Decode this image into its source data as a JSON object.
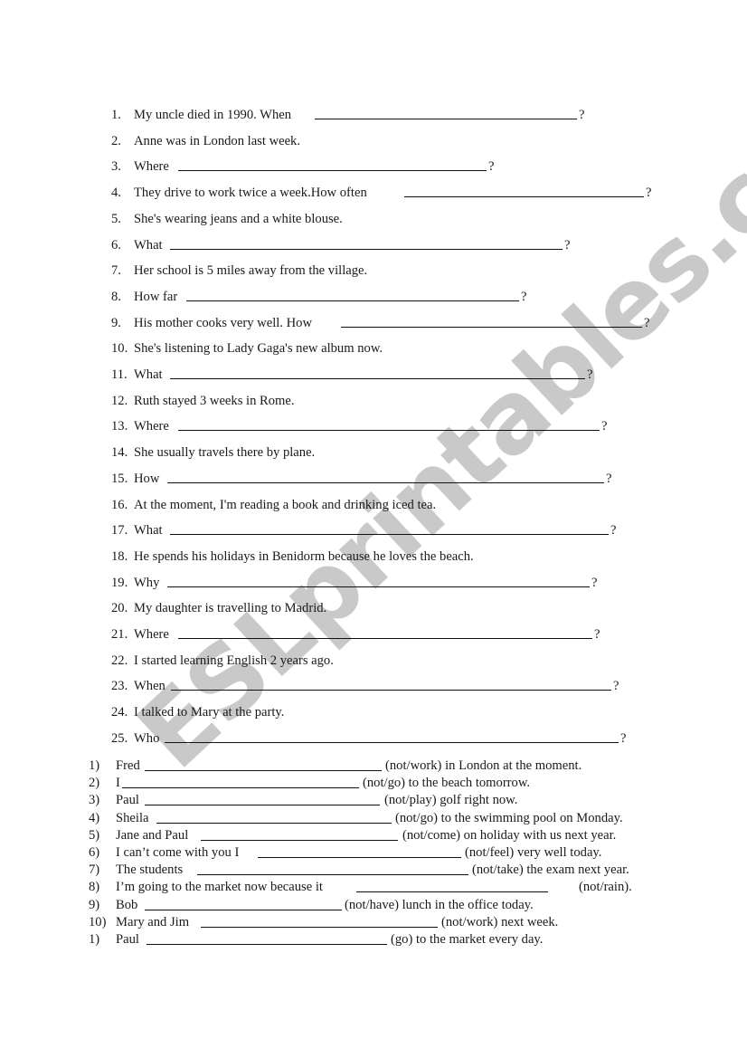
{
  "watermark": "ESLprintables.com",
  "section1": {
    "items": [
      {
        "num": "1.",
        "text": "My uncle died in 1990. When",
        "blank": true,
        "end": "?"
      },
      {
        "num": "2.",
        "text": "Anne was in London last week.",
        "blank": false,
        "end": ""
      },
      {
        "num": "3.",
        "text": "Where",
        "blank": true,
        "end": "?"
      },
      {
        "num": "4.",
        "text": "They drive to work twice a week.How often",
        "blank": true,
        "end": "?"
      },
      {
        "num": "5.",
        "text": "She's wearing jeans and a white blouse.",
        "blank": false,
        "end": ""
      },
      {
        "num": "6.",
        "text": "What",
        "blank": true,
        "end": "?"
      },
      {
        "num": "7.",
        "text": "Her school is 5 miles away from the village.",
        "blank": false,
        "end": ""
      },
      {
        "num": "8.",
        "text": "How far",
        "blank": true,
        "end": "?"
      },
      {
        "num": "9.",
        "text": "His mother cooks very well. How",
        "blank": true,
        "end": "?"
      },
      {
        "num": "10.",
        "text": "She's listening to Lady Gaga's new album now.",
        "blank": false,
        "end": ""
      },
      {
        "num": "11.",
        "text": "What",
        "blank": true,
        "end": "?"
      },
      {
        "num": "12.",
        "text": "Ruth stayed 3 weeks in Rome.",
        "blank": false,
        "end": ""
      },
      {
        "num": "13.",
        "text": "Where",
        "blank": true,
        "end": "?"
      },
      {
        "num": "14.",
        "text": "She usually travels there by plane.",
        "blank": false,
        "end": ""
      },
      {
        "num": "15.",
        "text": "How",
        "blank": true,
        "end": "?"
      },
      {
        "num": "16.",
        "text": "At the moment, I'm reading a book and drinking iced tea.",
        "blank": false,
        "end": ""
      },
      {
        "num": "17.",
        "text": "What",
        "blank": true,
        "end": "?"
      },
      {
        "num": "18.",
        "text": "He spends his holidays in Benidorm because he loves the beach.",
        "blank": false,
        "end": ""
      },
      {
        "num": "19.",
        "text": "Why",
        "blank": true,
        "end": "?"
      },
      {
        "num": "20.",
        "text": "My daughter is travelling to Madrid.",
        "blank": false,
        "end": ""
      },
      {
        "num": "21.",
        "text": "Where",
        "blank": true,
        "end": "?"
      },
      {
        "num": "22.",
        "text": "I started learning English 2 years ago.",
        "blank": false,
        "end": ""
      },
      {
        "num": "23.",
        "text": "When",
        "blank": true,
        "end": "?"
      },
      {
        "num": "24.",
        "text": "I talked to Mary at the party.",
        "blank": false,
        "end": ""
      },
      {
        "num": "25.",
        "text": "Who",
        "blank": true,
        "end": "?"
      }
    ]
  },
  "section2": {
    "items": [
      {
        "num": "1)",
        "before": "Fred",
        "after": "(not/work) in London at the moment."
      },
      {
        "num": "2)",
        "before": "I",
        "after": "(not/go) to the beach tomorrow."
      },
      {
        "num": "3)",
        "before": "Paul",
        "after": "(not/play) golf right now."
      },
      {
        "num": "4)",
        "before": "Sheila",
        "after": "(not/go) to the swimming pool on Monday."
      },
      {
        "num": "5)",
        "before": "Jane and Paul",
        "after": "(not/come) on holiday with us next year."
      },
      {
        "num": "6)",
        "before": "I can’t come with you I",
        "after": "(not/feel) very well today."
      },
      {
        "num": "7)",
        "before": "The students",
        "after": "(not/take) the exam next year."
      },
      {
        "num": "8)",
        "before": "I’m going to the market now because it",
        "after": "(not/rain)."
      },
      {
        "num": "9)",
        "before": "Bob",
        "after": "(not/have) lunch in the office today."
      },
      {
        "num": "10)",
        "before": "Mary and Jim",
        "after": "(not/work) next week."
      },
      {
        "num": "1)",
        "before": "Paul",
        "after": "(go) to the market every day."
      }
    ]
  }
}
